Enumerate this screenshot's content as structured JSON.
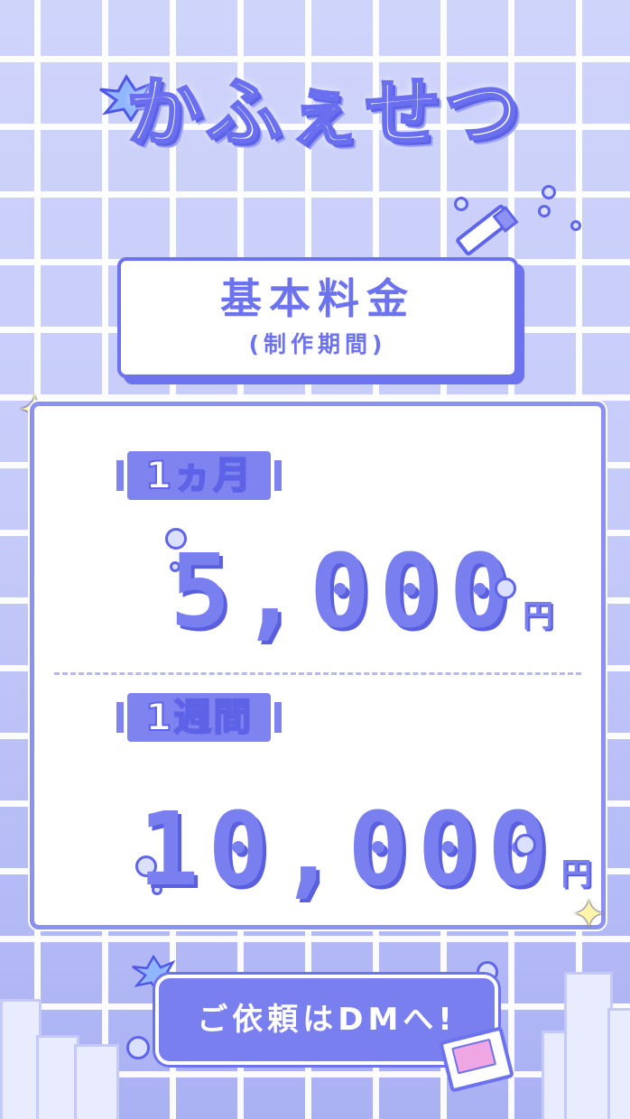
{
  "logo": {
    "text": "かふぇせつ"
  },
  "title_card": {
    "main": "基本料金",
    "sub": "(制作期間)"
  },
  "plans": [
    {
      "label": "1ヵ月",
      "price": "5,000",
      "unit": "円"
    },
    {
      "label": "1週間",
      "price": "10,000",
      "unit": "円"
    }
  ],
  "cta": {
    "label": "ご依頼はDMへ!"
  },
  "icons": {
    "logo_splash": "water-splash-icon",
    "pen": "pen-icon",
    "sparkle": "sparkle-icon",
    "bubble": "bubble-icon",
    "mail": "mail-icon"
  },
  "colors": {
    "accent": "#7a7ff0",
    "background": "#c6cbf9",
    "card": "#ffffff",
    "sparkle": "#fff4a8",
    "mail_heart": "#f0a6e3"
  }
}
